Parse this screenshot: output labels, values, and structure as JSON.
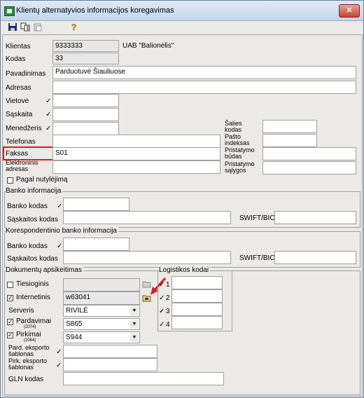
{
  "window": {
    "title": "Klientų alternatyvios informacijos koregavimas",
    "close": "✕"
  },
  "toolbar": {
    "save": "save-icon",
    "copy": "copy-icon",
    "paste": "paste-icon",
    "help": "help-icon"
  },
  "fields": {
    "klientas": {
      "label": "Klientas",
      "code": "9333333",
      "name": "UAB \"Balionėlis\""
    },
    "kodas": {
      "label": "Kodas",
      "value": "33"
    },
    "pavadinimas": {
      "label": "Pavadinimas",
      "value": "Parduotuvė Šiauliuose"
    },
    "adresas": {
      "label": "Adresas",
      "value": ""
    },
    "vietove": {
      "label": "Vietovė",
      "value": ""
    },
    "saskaita": {
      "label": "Sąskaita",
      "value": ""
    },
    "menedzeris": {
      "label": "Menedžeris",
      "value": ""
    },
    "telefonas": {
      "label": "Telefonas",
      "value": ""
    },
    "faksas": {
      "label": "Faksas",
      "value": "S01"
    },
    "el_adresas": {
      "label1": "Elektroninis",
      "label2": "adresas",
      "value": ""
    },
    "salies_kodas": {
      "label1": "Šalies",
      "label2": "kodas",
      "value": ""
    },
    "pasto_indeksas": {
      "label1": "Pašto",
      "label2": "indeksas",
      "value": ""
    },
    "pristatymo_budas": {
      "label1": "Pristatymo",
      "label2": "būdas",
      "value": ""
    },
    "pristatymo_salygos": {
      "label1": "Pristatymo",
      "label2": "sąlygos",
      "value": ""
    },
    "pagal_nutylejima": {
      "label": "Pagal nutylėjimą",
      "checked": false
    }
  },
  "banko": {
    "title": "Banko informacija",
    "bank_code_label": "Banko kodas",
    "account_label": "Sąskaitos kodas",
    "swift_label": "SWIFT/BIC"
  },
  "korespondentinio": {
    "title": "Korespondentinio banko informacija",
    "bank_code_label": "Banko kodas",
    "account_label": "Sąskaitos kodas",
    "swift_label": "SWIFT/BIC"
  },
  "dokumentu": {
    "title": "Dokumentų apsikeitimas",
    "tiesioginis": {
      "label": "Tiesioginis",
      "checked": false
    },
    "internetinis": {
      "label": "Internetinis",
      "checked": true,
      "value": "w63041"
    },
    "serveris": {
      "label": "Serveris",
      "value": "RIVILĖ"
    },
    "pardavimai": {
      "label": "Pardavimai",
      "sub": "(2074)",
      "checked": true,
      "value": "S865"
    },
    "pirkimai": {
      "label": "Pirkimai",
      "sub": "(2064)",
      "checked": true,
      "value": "S944"
    },
    "pard_eksporto": {
      "label1": "Pard. eksporto",
      "label2": "šablonas"
    },
    "pirk_eksporto": {
      "label1": "Pirk. eksporto",
      "label2": "šablonas"
    },
    "gln": {
      "label": "GLN kodas"
    }
  },
  "logistikos": {
    "title": "Logistikos kodai",
    "items": [
      "1",
      "2",
      "3",
      "4"
    ]
  },
  "check": "✓",
  "colors": {
    "highlight": "#e21b1b",
    "arrow": "#e21b1b"
  }
}
